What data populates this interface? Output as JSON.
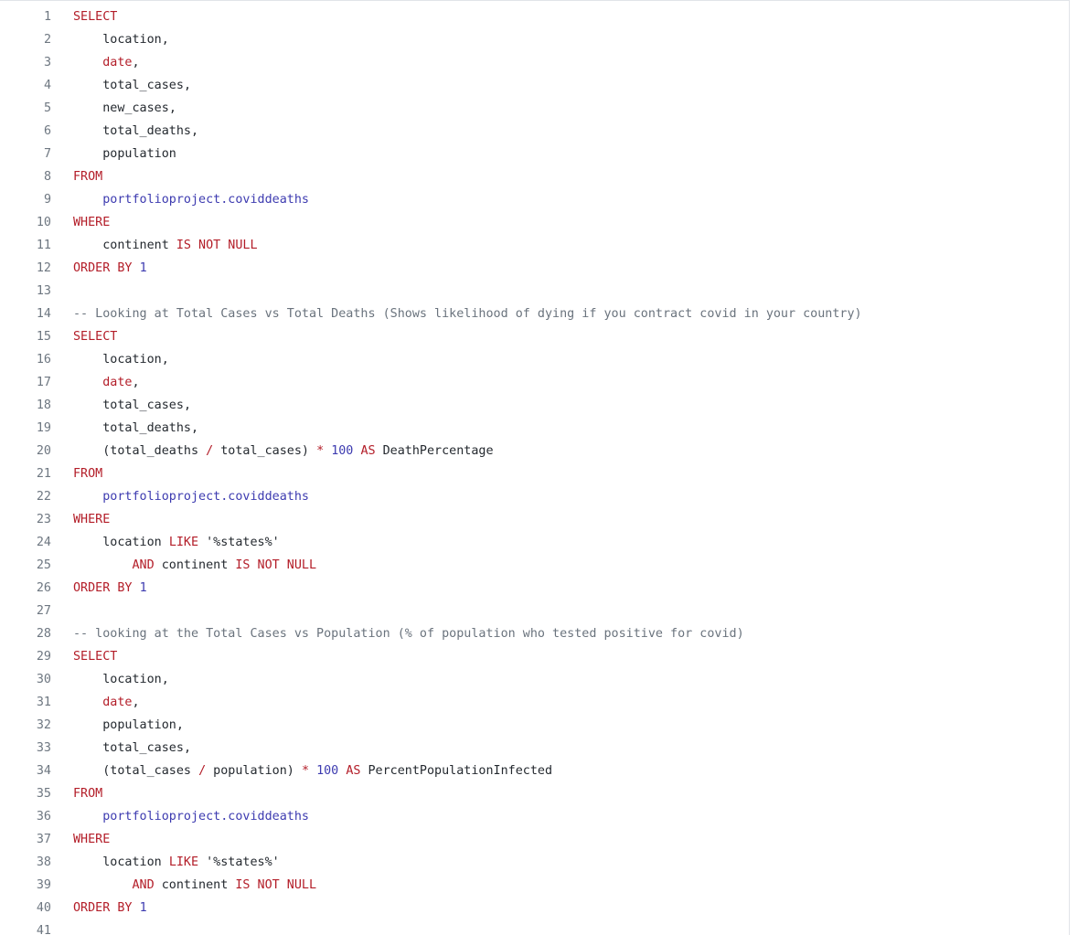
{
  "editor": {
    "lines": [
      [
        {
          "t": "SELECT",
          "c": "kw"
        }
      ],
      [
        {
          "t": "    "
        },
        {
          "t": "location",
          "c": "id"
        },
        {
          "t": ",",
          "c": "pu"
        }
      ],
      [
        {
          "t": "    "
        },
        {
          "t": "date",
          "c": "fn"
        },
        {
          "t": ",",
          "c": "pu"
        }
      ],
      [
        {
          "t": "    "
        },
        {
          "t": "total_cases",
          "c": "id"
        },
        {
          "t": ",",
          "c": "pu"
        }
      ],
      [
        {
          "t": "    "
        },
        {
          "t": "new_cases",
          "c": "id"
        },
        {
          "t": ",",
          "c": "pu"
        }
      ],
      [
        {
          "t": "    "
        },
        {
          "t": "total_deaths",
          "c": "id"
        },
        {
          "t": ",",
          "c": "pu"
        }
      ],
      [
        {
          "t": "    "
        },
        {
          "t": "population",
          "c": "id"
        }
      ],
      [
        {
          "t": "FROM",
          "c": "kw"
        }
      ],
      [
        {
          "t": "    "
        },
        {
          "t": "portfolioproject.coviddeaths",
          "c": "tbl"
        }
      ],
      [
        {
          "t": "WHERE",
          "c": "kw"
        }
      ],
      [
        {
          "t": "    "
        },
        {
          "t": "continent ",
          "c": "id"
        },
        {
          "t": "IS NOT NULL",
          "c": "kw"
        }
      ],
      [
        {
          "t": "ORDER BY ",
          "c": "kw"
        },
        {
          "t": "1",
          "c": "num"
        }
      ],
      [],
      [
        {
          "t": "-- Looking at Total Cases vs Total Deaths (Shows likelihood of dying if you contract covid in your country)",
          "c": "cm"
        }
      ],
      [
        {
          "t": "SELECT",
          "c": "kw"
        }
      ],
      [
        {
          "t": "    "
        },
        {
          "t": "location",
          "c": "id"
        },
        {
          "t": ",",
          "c": "pu"
        }
      ],
      [
        {
          "t": "    "
        },
        {
          "t": "date",
          "c": "fn"
        },
        {
          "t": ",",
          "c": "pu"
        }
      ],
      [
        {
          "t": "    "
        },
        {
          "t": "total_cases",
          "c": "id"
        },
        {
          "t": ",",
          "c": "pu"
        }
      ],
      [
        {
          "t": "    "
        },
        {
          "t": "total_deaths",
          "c": "id"
        },
        {
          "t": ",",
          "c": "pu"
        }
      ],
      [
        {
          "t": "    "
        },
        {
          "t": "(total_deaths ",
          "c": "id"
        },
        {
          "t": "/",
          "c": "op"
        },
        {
          "t": " total_cases) ",
          "c": "id"
        },
        {
          "t": "*",
          "c": "op"
        },
        {
          "t": " "
        },
        {
          "t": "100",
          "c": "num"
        },
        {
          "t": " "
        },
        {
          "t": "AS",
          "c": "kw"
        },
        {
          "t": " DeathPercentage",
          "c": "id"
        }
      ],
      [
        {
          "t": "FROM",
          "c": "kw"
        }
      ],
      [
        {
          "t": "    "
        },
        {
          "t": "portfolioproject.coviddeaths",
          "c": "tbl"
        }
      ],
      [
        {
          "t": "WHERE",
          "c": "kw"
        }
      ],
      [
        {
          "t": "    "
        },
        {
          "t": "location ",
          "c": "id"
        },
        {
          "t": "LIKE",
          "c": "kw"
        },
        {
          "t": " "
        },
        {
          "t": "'%states%'",
          "c": "str"
        }
      ],
      [
        {
          "t": "        "
        },
        {
          "t": "AND",
          "c": "kw"
        },
        {
          "t": " continent ",
          "c": "id"
        },
        {
          "t": "IS NOT NULL",
          "c": "kw"
        }
      ],
      [
        {
          "t": "ORDER BY ",
          "c": "kw"
        },
        {
          "t": "1",
          "c": "num"
        }
      ],
      [],
      [
        {
          "t": "-- looking at the Total Cases vs Population (% of population who tested positive for covid)",
          "c": "cm"
        }
      ],
      [
        {
          "t": "SELECT",
          "c": "kw"
        }
      ],
      [
        {
          "t": "    "
        },
        {
          "t": "location",
          "c": "id"
        },
        {
          "t": ",",
          "c": "pu"
        }
      ],
      [
        {
          "t": "    "
        },
        {
          "t": "date",
          "c": "fn"
        },
        {
          "t": ",",
          "c": "pu"
        }
      ],
      [
        {
          "t": "    "
        },
        {
          "t": "population",
          "c": "id"
        },
        {
          "t": ",",
          "c": "pu"
        }
      ],
      [
        {
          "t": "    "
        },
        {
          "t": "total_cases",
          "c": "id"
        },
        {
          "t": ",",
          "c": "pu"
        }
      ],
      [
        {
          "t": "    "
        },
        {
          "t": "(total_cases ",
          "c": "id"
        },
        {
          "t": "/",
          "c": "op"
        },
        {
          "t": " population) ",
          "c": "id"
        },
        {
          "t": "*",
          "c": "op"
        },
        {
          "t": " "
        },
        {
          "t": "100",
          "c": "num"
        },
        {
          "t": " "
        },
        {
          "t": "AS",
          "c": "kw"
        },
        {
          "t": " PercentPopulationInfected",
          "c": "id"
        }
      ],
      [
        {
          "t": "FROM",
          "c": "kw"
        }
      ],
      [
        {
          "t": "    "
        },
        {
          "t": "portfolioproject.coviddeaths",
          "c": "tbl"
        }
      ],
      [
        {
          "t": "WHERE",
          "c": "kw"
        }
      ],
      [
        {
          "t": "    "
        },
        {
          "t": "location ",
          "c": "id"
        },
        {
          "t": "LIKE",
          "c": "kw"
        },
        {
          "t": " "
        },
        {
          "t": "'%states%'",
          "c": "str"
        }
      ],
      [
        {
          "t": "        "
        },
        {
          "t": "AND",
          "c": "kw"
        },
        {
          "t": " continent ",
          "c": "id"
        },
        {
          "t": "IS NOT NULL",
          "c": "kw"
        }
      ],
      [
        {
          "t": "ORDER BY ",
          "c": "kw"
        },
        {
          "t": "1",
          "c": "num"
        }
      ],
      []
    ]
  }
}
